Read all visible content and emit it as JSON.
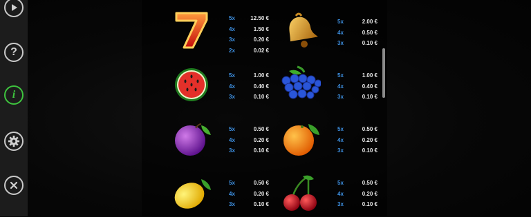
{
  "sidebar": {
    "buttons": [
      {
        "name": "play-button",
        "icon": "play-icon",
        "active": false
      },
      {
        "name": "help-button",
        "icon": "question-icon",
        "glyph": "?",
        "active": false
      },
      {
        "name": "info-button",
        "icon": "info-icon",
        "glyph": "i",
        "active": true
      },
      {
        "name": "settings-button",
        "icon": "gear-icon",
        "active": false
      },
      {
        "name": "close-button",
        "icon": "close-icon",
        "active": false
      }
    ]
  },
  "paytable": {
    "symbols": [
      {
        "name": "seven",
        "icon": "seven-icon",
        "glyph": "7",
        "payouts": [
          {
            "count": "5x",
            "amount": "12.50 €"
          },
          {
            "count": "4x",
            "amount": "1.50 €"
          },
          {
            "count": "3x",
            "amount": "0.20 €"
          },
          {
            "count": "2x",
            "amount": "0.02 €"
          }
        ]
      },
      {
        "name": "bell",
        "icon": "bell-icon",
        "payouts": [
          {
            "count": "5x",
            "amount": "2.00 €"
          },
          {
            "count": "4x",
            "amount": "0.50 €"
          },
          {
            "count": "3x",
            "amount": "0.10 €"
          }
        ]
      },
      {
        "name": "watermelon",
        "icon": "watermelon-icon",
        "payouts": [
          {
            "count": "5x",
            "amount": "1.00 €"
          },
          {
            "count": "4x",
            "amount": "0.40 €"
          },
          {
            "count": "3x",
            "amount": "0.10 €"
          }
        ]
      },
      {
        "name": "grapes",
        "icon": "grapes-icon",
        "payouts": [
          {
            "count": "5x",
            "amount": "1.00 €"
          },
          {
            "count": "4x",
            "amount": "0.40 €"
          },
          {
            "count": "3x",
            "amount": "0.10 €"
          }
        ]
      },
      {
        "name": "plum",
        "icon": "plum-icon",
        "payouts": [
          {
            "count": "5x",
            "amount": "0.50 €"
          },
          {
            "count": "4x",
            "amount": "0.20 €"
          },
          {
            "count": "3x",
            "amount": "0.10 €"
          }
        ]
      },
      {
        "name": "orange",
        "icon": "orange-icon",
        "payouts": [
          {
            "count": "5x",
            "amount": "0.50 €"
          },
          {
            "count": "4x",
            "amount": "0.20 €"
          },
          {
            "count": "3x",
            "amount": "0.10 €"
          }
        ]
      },
      {
        "name": "lemon",
        "icon": "lemon-icon",
        "payouts": [
          {
            "count": "5x",
            "amount": "0.50 €"
          },
          {
            "count": "4x",
            "amount": "0.20 €"
          },
          {
            "count": "3x",
            "amount": "0.10 €"
          }
        ]
      },
      {
        "name": "cherry",
        "icon": "cherry-icon",
        "payouts": [
          {
            "count": "5x",
            "amount": "0.50 €"
          },
          {
            "count": "4x",
            "amount": "0.20 €"
          },
          {
            "count": "3x",
            "amount": "0.10 €"
          }
        ]
      }
    ]
  },
  "colors": {
    "count": "#3d8fe0",
    "amount": "#e8e8e8",
    "active": "#3ec43e",
    "sidebar": "#1c1c1c"
  }
}
